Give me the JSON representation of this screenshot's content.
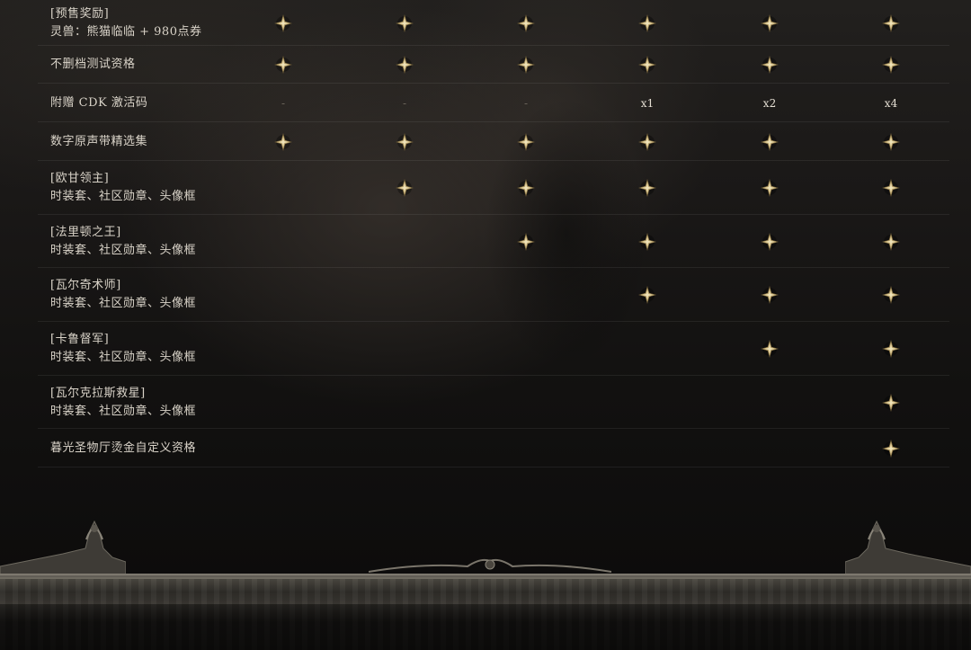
{
  "columns_count": 6,
  "rows": [
    {
      "label": [
        "[预售奖励]",
        "灵兽：熊猫临临 + 980点券"
      ],
      "cells": [
        "star",
        "star",
        "star",
        "star",
        "star",
        "star"
      ]
    },
    {
      "label": [
        "不删档测试资格"
      ],
      "cells": [
        "star",
        "star",
        "star",
        "star",
        "star",
        "star"
      ]
    },
    {
      "label": [
        "附赠 CDK 激活码"
      ],
      "cells": [
        "-",
        "-",
        "-",
        "x1",
        "x2",
        "x4"
      ]
    },
    {
      "label": [
        "数字原声带精选集"
      ],
      "cells": [
        "star",
        "star",
        "star",
        "star",
        "star",
        "star"
      ]
    },
    {
      "label": [
        "[欧甘领主]",
        "时装套、社区勋章、头像框"
      ],
      "cells": [
        "",
        "star",
        "star",
        "star",
        "star",
        "star"
      ]
    },
    {
      "label": [
        "[法里顿之王]",
        "时装套、社区勋章、头像框"
      ],
      "cells": [
        "",
        "",
        "star",
        "star",
        "star",
        "star"
      ]
    },
    {
      "label": [
        "[瓦尔奇术师]",
        "时装套、社区勋章、头像框"
      ],
      "cells": [
        "",
        "",
        "",
        "star",
        "star",
        "star"
      ]
    },
    {
      "label": [
        "[卡鲁督军]",
        "时装套、社区勋章、头像框"
      ],
      "cells": [
        "",
        "",
        "",
        "",
        "star",
        "star"
      ]
    },
    {
      "label": [
        "[瓦尔克拉斯救星]",
        "时装套、社区勋章、头像框"
      ],
      "cells": [
        "",
        "",
        "",
        "",
        "",
        "star"
      ]
    },
    {
      "label": [
        "暮光圣物厅烫金自定义资格"
      ],
      "cells": [
        "",
        "",
        "",
        "",
        "",
        "star"
      ]
    }
  ],
  "colors": {
    "text": "#d9d3c8",
    "star_gold": "#c9b27a",
    "divider": "rgba(255,255,255,0.07)"
  },
  "icons": {
    "included": "compass-star-icon",
    "not_included": "dash"
  }
}
